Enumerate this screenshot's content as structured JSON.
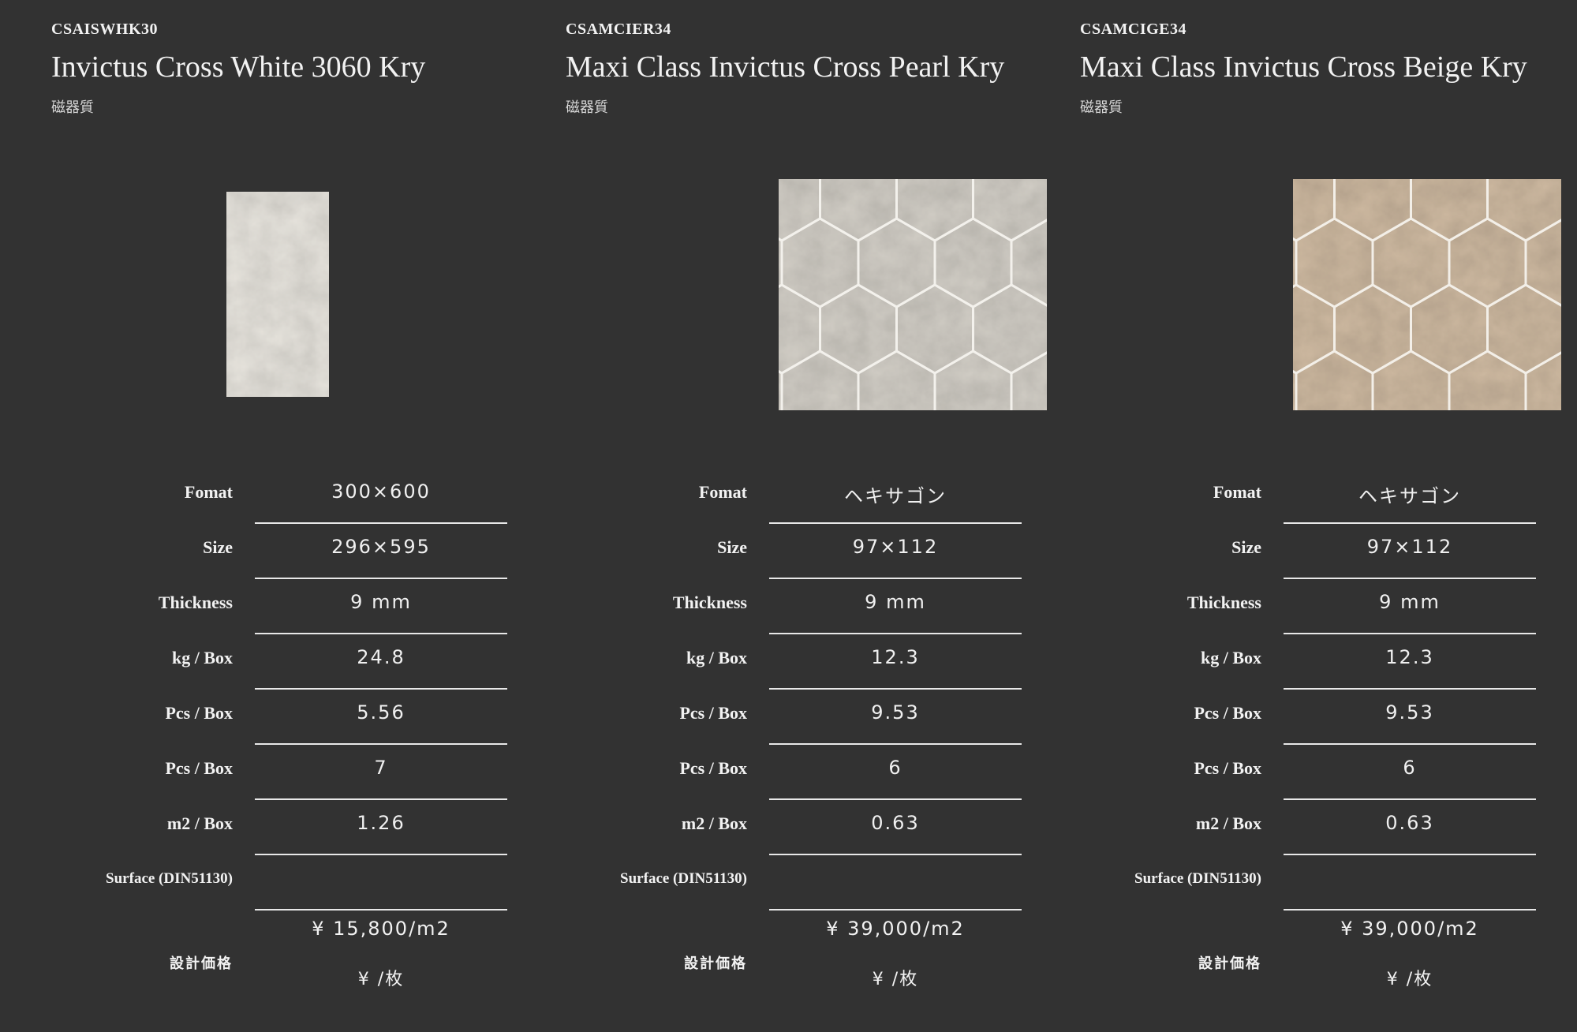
{
  "colors": {
    "background": "#323232",
    "text": "#f2f2f2",
    "rule": "#e8e8e8"
  },
  "spec_labels": {
    "fomat": "Fomat",
    "size": "Size",
    "thickness": "Thickness",
    "kg_box": "kg / Box",
    "pcs_box_1": "Pcs / Box",
    "pcs_box_2": "Pcs / Box",
    "m2_box": "m2 / Box",
    "surface": "Surface (DIN51130)",
    "price": "設計価格"
  },
  "products": [
    {
      "code": "CSAISWHK30",
      "name": "Invictus Cross White 3060 Kry",
      "material": "磁器質",
      "image": "rectangular-white-marble-tile",
      "specs": {
        "fomat": "300×600",
        "size": "296×595",
        "thickness": "9 mm",
        "kg_box": "24.8",
        "pcs_box_1": "5.56",
        "pcs_box_2": "7",
        "m2_box": "1.26",
        "surface": ""
      },
      "price_m2": "¥ 15,800/m2",
      "price_piece": "¥ /枚"
    },
    {
      "code": "CSAMCIER34",
      "name": "Maxi Class Invictus Cross Pearl Kry",
      "material": "磁器質",
      "image": "hexagon-pearl-mosaic-tile",
      "specs": {
        "fomat": "ヘキサゴン",
        "size": "97×112",
        "thickness": "9 mm",
        "kg_box": "12.3",
        "pcs_box_1": "9.53",
        "pcs_box_2": "6",
        "m2_box": "0.63",
        "surface": ""
      },
      "price_m2": "¥ 39,000/m2",
      "price_piece": "¥ /枚"
    },
    {
      "code": "CSAMCIGE34",
      "name": "Maxi Class Invictus Cross Beige Kry",
      "material": "磁器質",
      "image": "hexagon-beige-mosaic-tile",
      "specs": {
        "fomat": "ヘキサゴン",
        "size": "97×112",
        "thickness": "9 mm",
        "kg_box": "12.3",
        "pcs_box_1": "9.53",
        "pcs_box_2": "6",
        "m2_box": "0.63",
        "surface": ""
      },
      "price_m2": "¥ 39,000/m2",
      "price_piece": "¥ /枚"
    }
  ]
}
